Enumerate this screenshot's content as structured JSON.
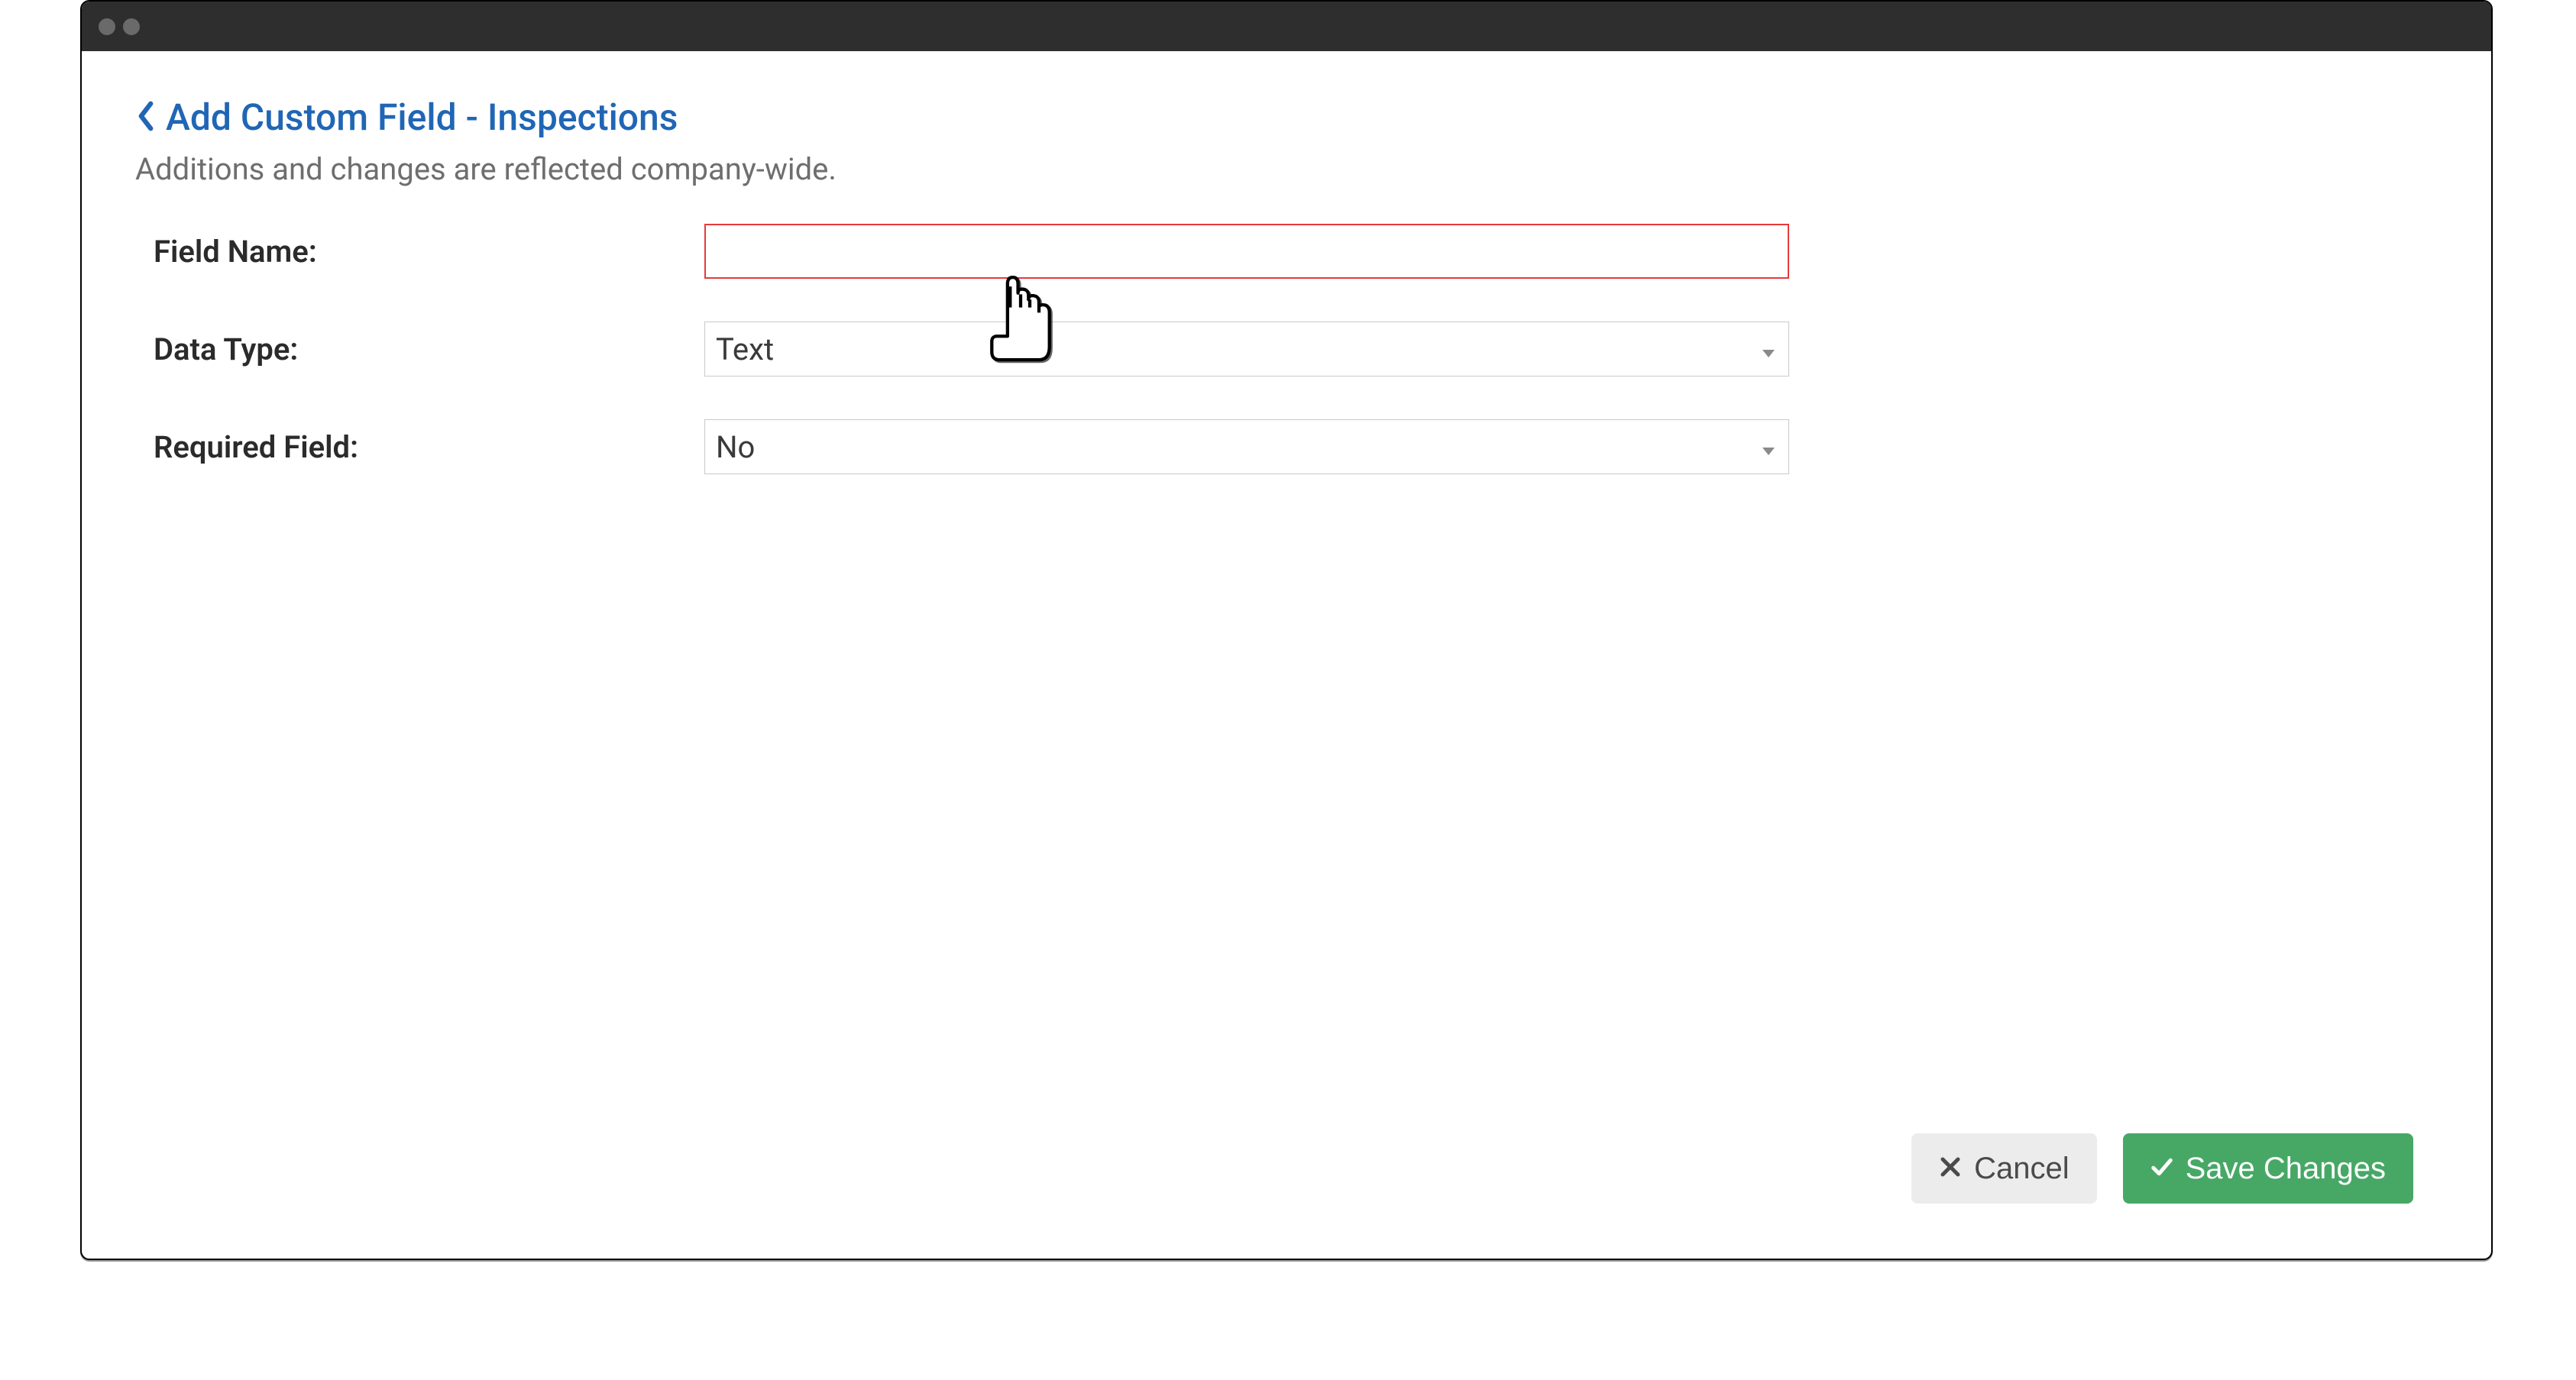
{
  "header": {
    "title": "Add Custom Field - Inspections",
    "subtitle": "Additions and changes are reflected company-wide."
  },
  "form": {
    "field_name": {
      "label": "Field Name:",
      "value": ""
    },
    "data_type": {
      "label": "Data Type:",
      "value": "Text"
    },
    "required_field": {
      "label": "Required Field:",
      "value": "No"
    }
  },
  "footer": {
    "cancel_label": "Cancel",
    "save_label": "Save Changes"
  }
}
